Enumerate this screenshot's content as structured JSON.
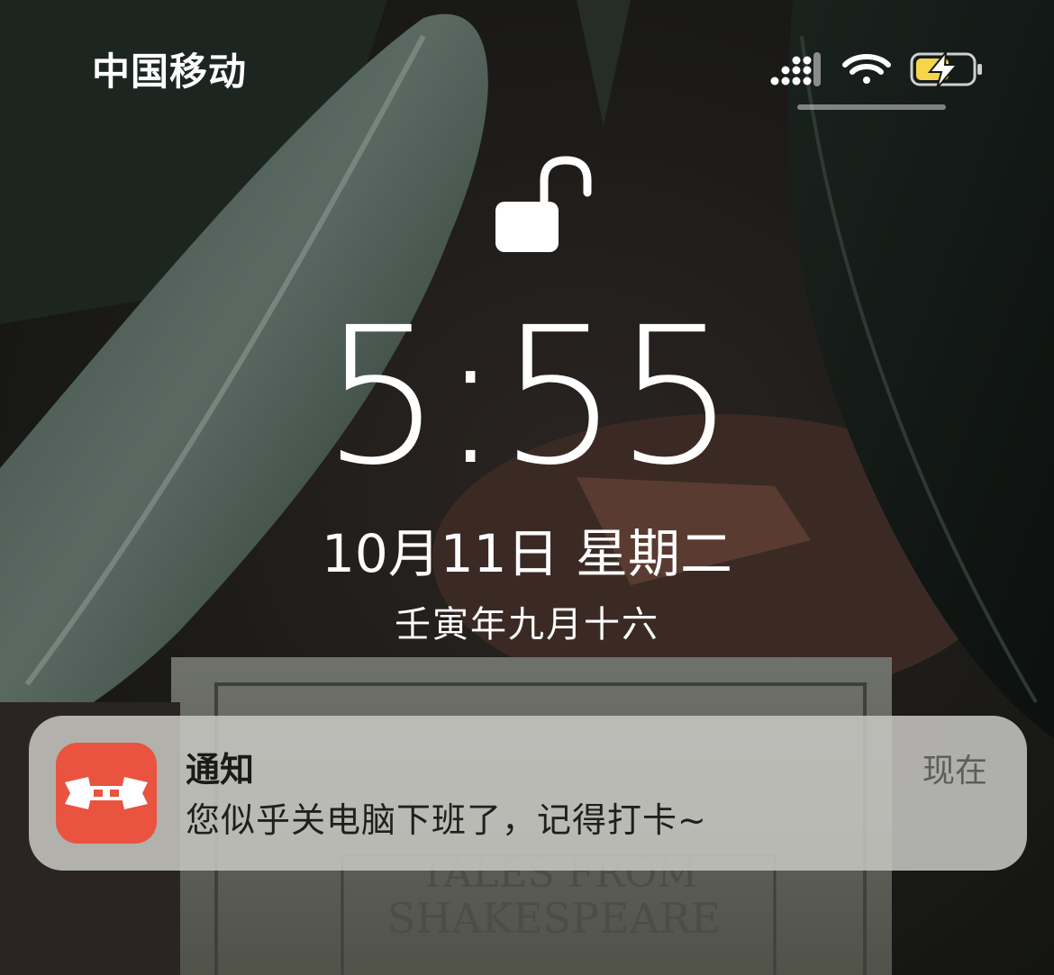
{
  "status_bar": {
    "carrier": "中国移动",
    "icons": [
      "cellular-signal-icon",
      "wifi-icon",
      "battery-charging-icon"
    ],
    "battery_color": "#f5d54a"
  },
  "lock_screen": {
    "lock_state": "unlocked",
    "time": "5:55",
    "date": "10月11日 星期二",
    "lunar_date": "壬寅年九月十六"
  },
  "notification": {
    "app_icon": "bow-tie-icon",
    "app_icon_color": "#e9533f",
    "title": "通知",
    "body": "您似乎关电脑下班了，记得打卡~",
    "time": "现在"
  }
}
